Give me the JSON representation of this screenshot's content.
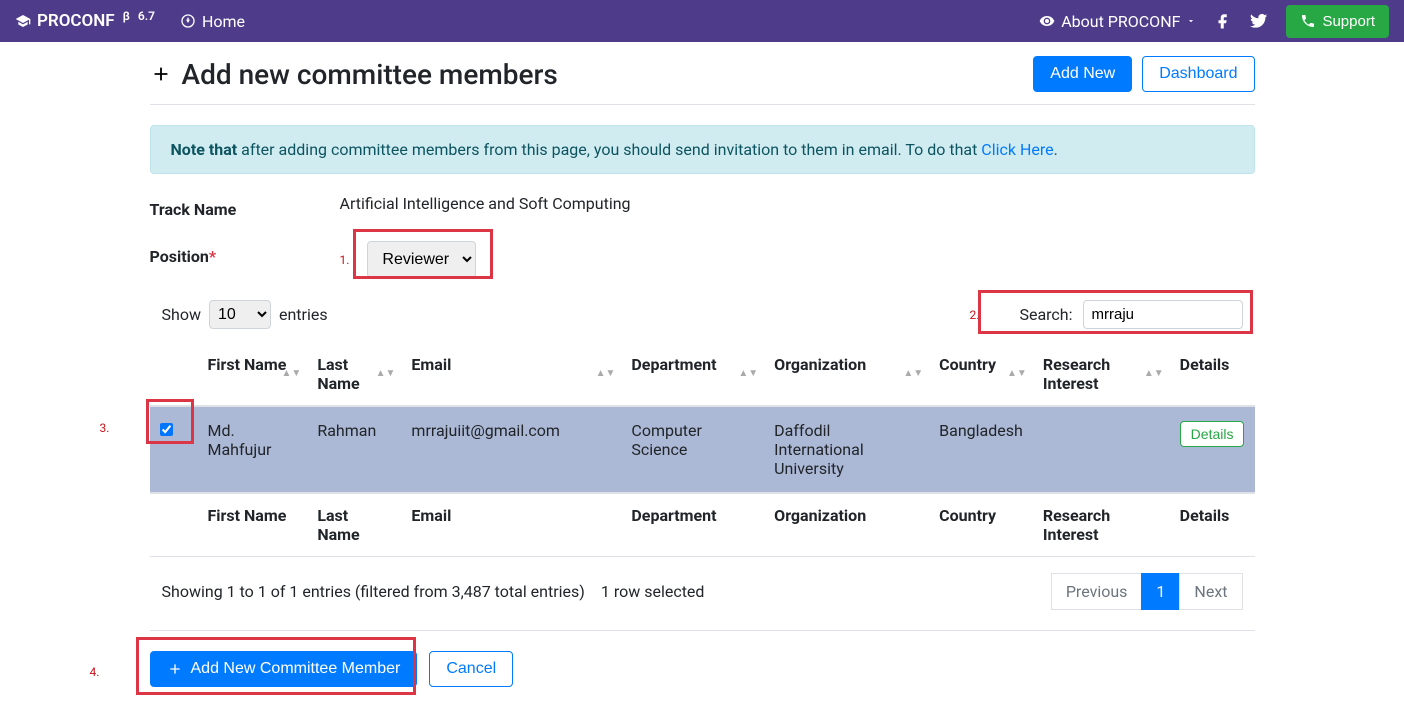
{
  "navbar": {
    "brand": "PROCONF",
    "version": "6.7",
    "home": "Home",
    "about": "About PROCONF",
    "support": "Support"
  },
  "header": {
    "title": "Add new committee members",
    "add_new": "Add New",
    "dashboard": "Dashboard"
  },
  "alert": {
    "note": "Note that",
    "text": " after adding committee members from this page, you should send invitation to them in email. To do that ",
    "link": "Click Here"
  },
  "form": {
    "track_label": "Track Name",
    "track_value": "Artificial Intelligence and Soft Computing",
    "position_label": "Position",
    "position_value": "Reviewer"
  },
  "markers": {
    "m1": "1.",
    "m2": "2.",
    "m3": "3.",
    "m4": "4."
  },
  "dt": {
    "show": "Show",
    "show_value": "10",
    "entries": "entries",
    "search_label": "Search:",
    "search_value": "mrraju",
    "info": "Showing 1 to 1 of 1 entries (filtered from 3,487 total entries)",
    "selected": "1 row selected",
    "prev": "Previous",
    "page": "1",
    "next": "Next"
  },
  "cols": {
    "first_name": "First Name",
    "last_name": "Last Name",
    "email": "Email",
    "department": "Department",
    "organization": "Organization",
    "country": "Country",
    "research": "Research Interest",
    "details": "Details"
  },
  "row": {
    "first_name": "Md. Mahfujur",
    "last_name": "Rahman",
    "email": "mrrajuiit@gmail.com",
    "department": "Computer Science",
    "organization": "Daffodil International University",
    "country": "Bangladesh",
    "details_btn": "Details"
  },
  "actions": {
    "add": "Add New Committee Member",
    "cancel": "Cancel"
  }
}
